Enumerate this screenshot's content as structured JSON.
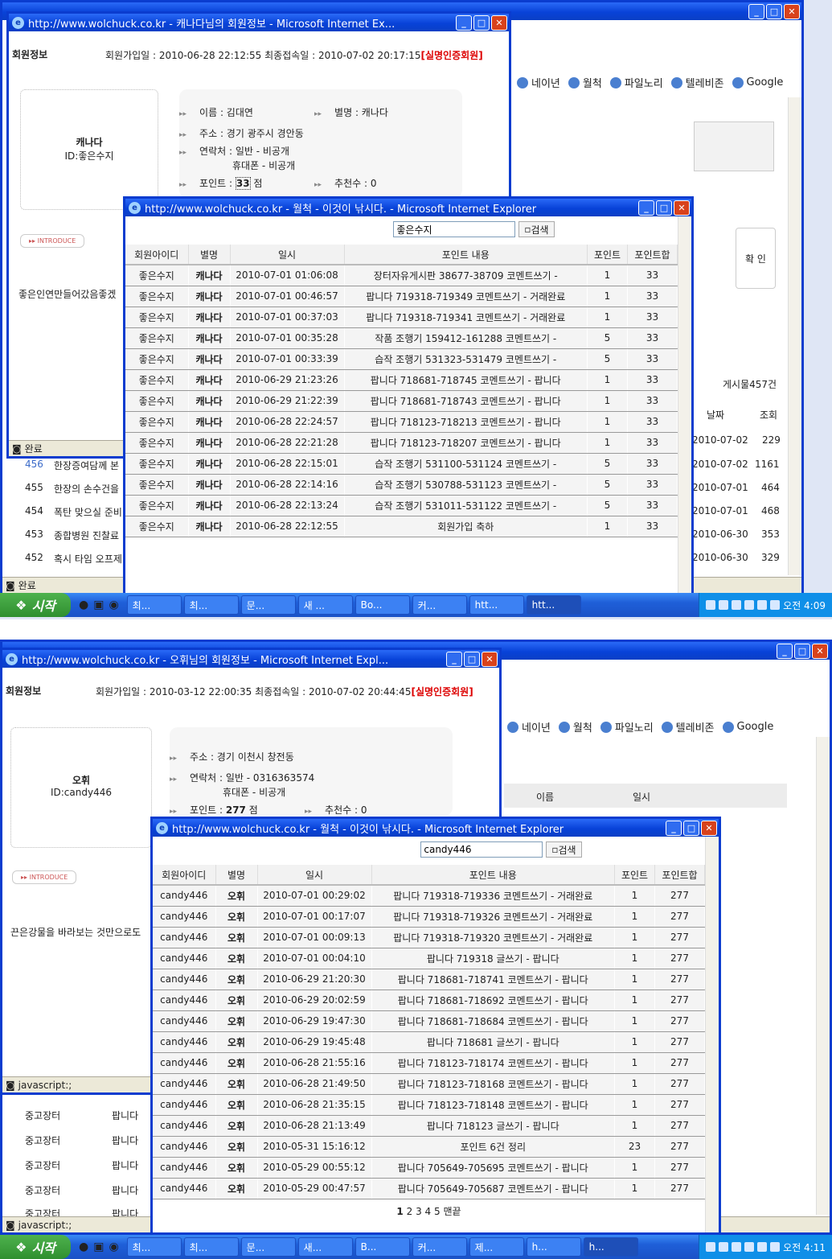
{
  "shot1": {
    "bg_bookmarks": [
      "네이년",
      "월척",
      "파일노리",
      "텔레비존",
      "Google"
    ],
    "bg_post_count": "게시물457건",
    "bg_confirm": "확 인",
    "bg_headers": {
      "date": "날짜",
      "views": "조회"
    },
    "bg_rows": [
      {
        "no": "456",
        "title": "한장증여담께 본",
        "date": "2010-07-02",
        "views": "1161"
      },
      {
        "no": "455",
        "title": "한장의 손수건을",
        "date": "2010-07-01",
        "views": "464"
      },
      {
        "no": "454",
        "title": "폭탄 맞으실 준비",
        "date": "2010-07-01",
        "views": "468"
      },
      {
        "no": "453",
        "title": "종합병원 진찰료",
        "date": "2010-06-30",
        "views": "353"
      },
      {
        "no": "452",
        "title": "혹시 타임 오프제",
        "date": "2010-06-30",
        "views": "329"
      }
    ],
    "bg_row_top": {
      "date": "2010-07-02",
      "views": "229"
    },
    "bg_status": "완료",
    "member_window": {
      "title": "http://www.wolchuck.co.kr - 캐나다님의 회원정보 - Microsoft Internet Ex...",
      "section": "회원정보",
      "join_text": "회원가입일 : 2010-06-28 22:12:55 최종접속일 : 2010-07-02 20:17:15",
      "verified": "[실명인증회원]",
      "nick": "캐나다",
      "id_label": "ID:좋은수지",
      "name": "이름 : 김대연",
      "alias": "별명 : 캐나다",
      "address": "주소 : 경기 광주시 경안동",
      "contact": "연락처 : 일반 - 비공개",
      "mobile": "휴대폰 - 비공개",
      "points_label": "포인트 :",
      "points_value": "33",
      "points_unit": "점",
      "recommend": "추천수 : 0",
      "intro_btn": "INTRODUCE",
      "intro_text": "좋은인연만들어갔음좋겠",
      "status": "완료"
    },
    "points_window": {
      "title": "http://www.wolchuck.co.kr - 월척 - 이것이 낚시다. - Microsoft Internet Explorer",
      "search_value": "좋은수지",
      "search_btn": "검색",
      "headers": [
        "회원아이디",
        "별명",
        "일시",
        "포인트 내용",
        "포인트",
        "포인트합"
      ],
      "rows": [
        [
          "좋은수지",
          "캐나다",
          "2010-07-01 01:06:08",
          "장터자유게시판 38677-38709 코멘트쓰기 -",
          "1",
          "33"
        ],
        [
          "좋은수지",
          "캐나다",
          "2010-07-01 00:46:57",
          "팝니다 719318-719349 코멘트쓰기 - 거래완료",
          "1",
          "33"
        ],
        [
          "좋은수지",
          "캐나다",
          "2010-07-01 00:37:03",
          "팝니다 719318-719341 코멘트쓰기 - 거래완료",
          "1",
          "33"
        ],
        [
          "좋은수지",
          "캐나다",
          "2010-07-01 00:35:28",
          "작품 조행기 159412-161288 코멘트쓰기 -",
          "5",
          "33"
        ],
        [
          "좋은수지",
          "캐나다",
          "2010-07-01 00:33:39",
          "습작 조행기 531323-531479 코멘트쓰기 -",
          "5",
          "33"
        ],
        [
          "좋은수지",
          "캐나다",
          "2010-06-29 21:23:26",
          "팝니다 718681-718745 코멘트쓰기 - 팝니다",
          "1",
          "33"
        ],
        [
          "좋은수지",
          "캐나다",
          "2010-06-29 21:22:39",
          "팝니다 718681-718743 코멘트쓰기 - 팝니다",
          "1",
          "33"
        ],
        [
          "좋은수지",
          "캐나다",
          "2010-06-28 22:24:57",
          "팝니다 718123-718213 코멘트쓰기 - 팝니다",
          "1",
          "33"
        ],
        [
          "좋은수지",
          "캐나다",
          "2010-06-28 22:21:28",
          "팝니다 718123-718207 코멘트쓰기 - 팝니다",
          "1",
          "33"
        ],
        [
          "좋은수지",
          "캐나다",
          "2010-06-28 22:15:01",
          "습작 조행기 531100-531124 코멘트쓰기 -",
          "5",
          "33"
        ],
        [
          "좋은수지",
          "캐나다",
          "2010-06-28 22:14:16",
          "습작 조행기 530788-531123 코멘트쓰기 -",
          "5",
          "33"
        ],
        [
          "좋은수지",
          "캐나다",
          "2010-06-28 22:13:24",
          "습작 조행기 531011-531122 코멘트쓰기 -",
          "5",
          "33"
        ],
        [
          "좋은수지",
          "캐나다",
          "2010-06-28 22:12:55",
          "회원가입 축하",
          "1",
          "33"
        ]
      ]
    },
    "taskbar": {
      "start": "시작",
      "tasks": [
        "최...",
        "최...",
        "문...",
        "새 ...",
        "Bo...",
        "커...",
        "htt...",
        "htt..."
      ],
      "clock": "오전 4:09"
    }
  },
  "shot2": {
    "bg_bookmarks": [
      "네이년",
      "월척",
      "파일노리",
      "텔레비존",
      "Google"
    ],
    "bg_headers": {
      "name": "이름",
      "date": "일시"
    },
    "bg_list": [
      [
        "중고장터",
        "팝니다"
      ],
      [
        "중고장터",
        "팝니다"
      ],
      [
        "중고장터",
        "팝니다"
      ],
      [
        "중고장터",
        "팝니다"
      ],
      [
        "중고장터",
        "팝니다"
      ]
    ],
    "bg_status": "javascript:;",
    "member_window": {
      "title": "http://www.wolchuck.co.kr - 오휘님의 회원정보 - Microsoft Internet Expl...",
      "section": "회원정보",
      "join_text": "회원가입일 : 2010-03-12 22:00:35 최종접속일 : 2010-07-02 20:44:45",
      "verified": "[실명인증회원]",
      "nick": "오휘",
      "id_label": "ID:candy446",
      "address": "주소 : 경기 이천시 창전동",
      "contact": "연락처 : 일반 - 0316363574",
      "mobile": "휴대폰 - 비공개",
      "points_label": "포인트 :",
      "points_value": "277",
      "points_unit": "점",
      "recommend": "추천수 : 0",
      "intro_btn": "INTRODUCE",
      "intro_text": "끈은강물을 바라보는 것만으로도",
      "status": "javascript:;"
    },
    "points_window": {
      "title": "http://www.wolchuck.co.kr - 월척 - 이것이 낚시다. - Microsoft Internet Explorer",
      "search_value": "candy446",
      "search_btn": "검색",
      "headers": [
        "회원아이디",
        "별명",
        "일시",
        "포인트 내용",
        "포인트",
        "포인트합"
      ],
      "rows": [
        [
          "candy446",
          "오휘",
          "2010-07-01 00:29:02",
          "팝니다 719318-719336 코멘트쓰기 - 거래완료",
          "1",
          "277"
        ],
        [
          "candy446",
          "오휘",
          "2010-07-01 00:17:07",
          "팝니다 719318-719326 코멘트쓰기 - 거래완료",
          "1",
          "277"
        ],
        [
          "candy446",
          "오휘",
          "2010-07-01 00:09:13",
          "팝니다 719318-719320 코멘트쓰기 - 거래완료",
          "1",
          "277"
        ],
        [
          "candy446",
          "오휘",
          "2010-07-01 00:04:10",
          "팝니다 719318 글쓰기 - 팝니다",
          "1",
          "277"
        ],
        [
          "candy446",
          "오휘",
          "2010-06-29 21:20:30",
          "팝니다 718681-718741 코멘트쓰기 - 팝니다",
          "1",
          "277"
        ],
        [
          "candy446",
          "오휘",
          "2010-06-29 20:02:59",
          "팝니다 718681-718692 코멘트쓰기 - 팝니다",
          "1",
          "277"
        ],
        [
          "candy446",
          "오휘",
          "2010-06-29 19:47:30",
          "팝니다 718681-718684 코멘트쓰기 - 팝니다",
          "1",
          "277"
        ],
        [
          "candy446",
          "오휘",
          "2010-06-29 19:45:48",
          "팝니다 718681 글쓰기 - 팝니다",
          "1",
          "277"
        ],
        [
          "candy446",
          "오휘",
          "2010-06-28 21:55:16",
          "팝니다 718123-718174 코멘트쓰기 - 팝니다",
          "1",
          "277"
        ],
        [
          "candy446",
          "오휘",
          "2010-06-28 21:49:50",
          "팝니다 718123-718168 코멘트쓰기 - 팝니다",
          "1",
          "277"
        ],
        [
          "candy446",
          "오휘",
          "2010-06-28 21:35:15",
          "팝니다 718123-718148 코멘트쓰기 - 팝니다",
          "1",
          "277"
        ],
        [
          "candy446",
          "오휘",
          "2010-06-28 21:13:49",
          "팝니다 718123 글쓰기 - 팝니다",
          "1",
          "277"
        ],
        [
          "candy446",
          "오휘",
          "2010-05-31 15:16:12",
          "포인트 6건 정리",
          "23",
          "277"
        ],
        [
          "candy446",
          "오휘",
          "2010-05-29 00:55:12",
          "팝니다 705649-705695 코멘트쓰기 - 팝니다",
          "1",
          "277"
        ],
        [
          "candy446",
          "오휘",
          "2010-05-29 00:47:57",
          "팝니다 705649-705687 코멘트쓰기 - 팝니다",
          "1",
          "277"
        ]
      ],
      "pages": [
        "1",
        "2",
        "3",
        "4",
        "5"
      ],
      "page_end": "맨끝"
    },
    "taskbar": {
      "start": "시작",
      "tasks": [
        "최...",
        "최...",
        "문...",
        "새...",
        "B...",
        "커...",
        "제...",
        "h...",
        "h..."
      ],
      "clock": "오전 4:11"
    }
  }
}
